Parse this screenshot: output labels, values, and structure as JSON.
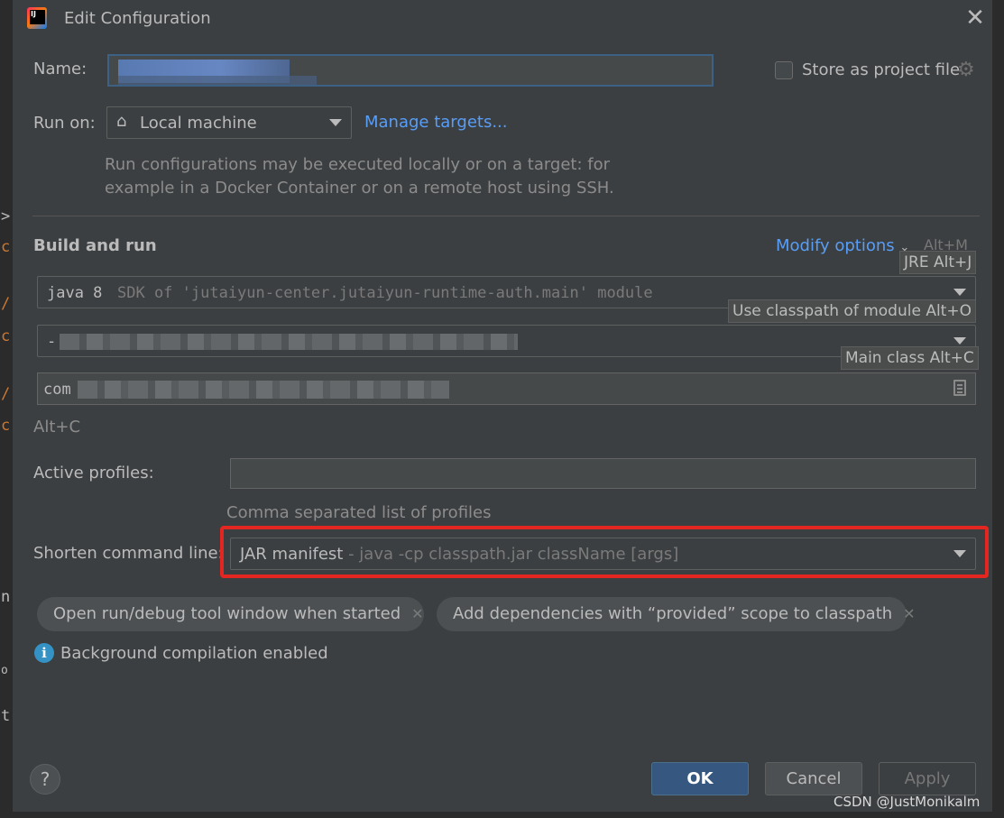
{
  "window": {
    "title": "Edit Configuration"
  },
  "editor_gutter": {
    "glyphs": [
      ">",
      "c",
      "/",
      "c",
      "/",
      "c",
      "n",
      "o",
      "t"
    ]
  },
  "name": {
    "label": "Name:",
    "value": ""
  },
  "store_project": {
    "label": "Store as project file",
    "checked": false
  },
  "run_on": {
    "label": "Run on:",
    "value": "Local machine",
    "manage_link": "Manage targets...",
    "hint_line1": "Run configurations may be executed locally or on a target: for",
    "hint_line2": "example in a Docker Container or on a remote host using SSH."
  },
  "build_run": {
    "title": "Build and run",
    "modify_options": "Modify options",
    "modify_shortcut": "Alt+M",
    "jre": {
      "main": "java 8",
      "detail": "SDK of 'jutaiyun-center.jutaiyun-runtime-auth.main' module",
      "tooltip": "JRE Alt+J"
    },
    "classpath": {
      "prefix": "-",
      "tooltip": "Use classpath of module Alt+O"
    },
    "main_class": {
      "prefix": "com",
      "tooltip": "Main class Alt+C"
    },
    "alt_c": "Alt+C"
  },
  "active_profiles": {
    "label": "Active profiles:",
    "value": "",
    "hint": "Comma separated list of profiles"
  },
  "shorten_cmd": {
    "label": "Shorten command line:",
    "value": "JAR manifest",
    "detail": " - java -cp classpath.jar className [args]"
  },
  "chips": [
    {
      "label": "Open run/debug tool window when started"
    },
    {
      "label": "Add dependencies with “provided” scope to classpath"
    }
  ],
  "info": {
    "text": "Background compilation enabled"
  },
  "buttons": {
    "help": "?",
    "ok": "OK",
    "cancel": "Cancel",
    "apply": "Apply"
  },
  "watermark": "CSDN @JustMonikalm",
  "colors": {
    "dialog_bg": "#3c3f41",
    "link": "#589df6",
    "highlight_border": "#e3261f",
    "ok_button": "#365880"
  }
}
